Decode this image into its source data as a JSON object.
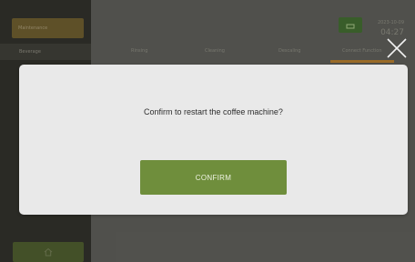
{
  "sidebar": {
    "header_label": "Maintenance",
    "items": [
      {
        "label": "Beverage"
      }
    ],
    "home_icon": "home-icon"
  },
  "tabs": [
    {
      "label": "Rinsing"
    },
    {
      "label": "Cleaning"
    },
    {
      "label": "Descaling"
    },
    {
      "label": "Connect Function"
    }
  ],
  "status": {
    "chip_icon": "connection-icon",
    "date": "2023-10-09",
    "time": "04:27"
  },
  "close_icon": "close-icon",
  "dialog": {
    "message": "Confirm to restart the coffee machine?",
    "confirm_label": "CONFIRM"
  },
  "colors": {
    "accent": "#b47a2a",
    "confirm": "#6f8e3c",
    "sidebar": "#2b2b26"
  }
}
